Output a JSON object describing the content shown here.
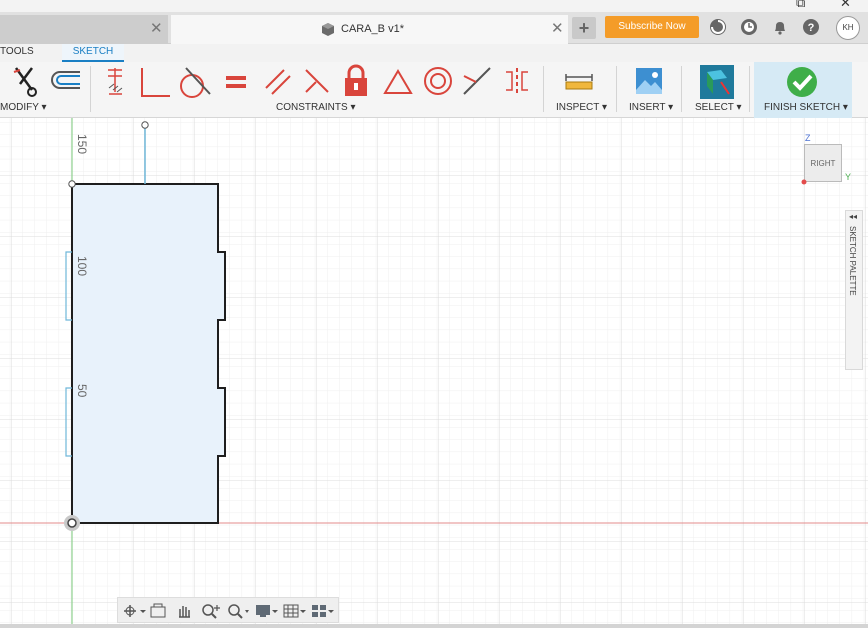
{
  "window": {
    "restore": "⧉",
    "close": "✕"
  },
  "tabs": {
    "title": "CARA_B v1*"
  },
  "header": {
    "subscribe_label": "Subscribe Now",
    "avatar": "KH"
  },
  "ribbon": {
    "tabs": [
      "TOOLS",
      "SKETCH"
    ],
    "groups": [
      "MODIFY ▾",
      "CONSTRAINTS ▾",
      "INSPECT ▾",
      "INSERT ▾",
      "SELECT ▾",
      "FINISH SKETCH ▾"
    ]
  },
  "canvas": {
    "dimension_labels": [
      "150",
      "100",
      "50"
    ],
    "viewcube_face": "RIGHT",
    "axis_labels": {
      "z": "Z",
      "y": "Y"
    },
    "palette_label": "SKETCH PALETTE"
  },
  "colors": {
    "accent": "#1a7fc4",
    "subscribe": "#f49c28",
    "finish": "#3fae49",
    "constraint": "#d9453c"
  }
}
